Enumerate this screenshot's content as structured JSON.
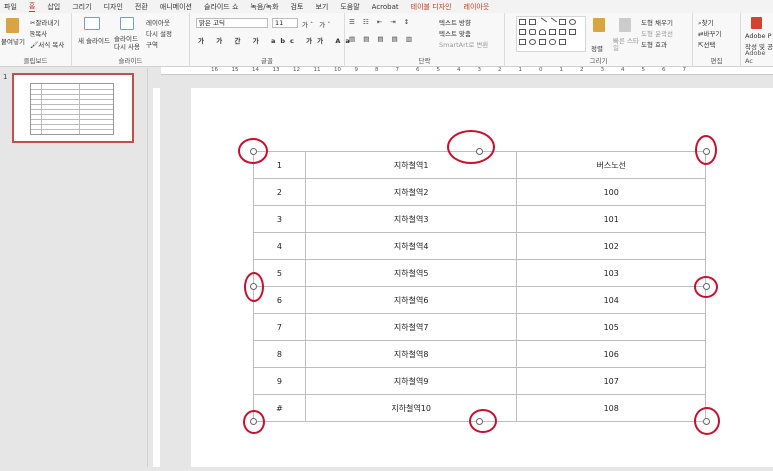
{
  "menu": {
    "tabs": [
      "파일",
      "홈",
      "삽입",
      "그리기",
      "디자인",
      "전환",
      "애니메이션",
      "슬라이드 쇼",
      "녹음/녹화",
      "검토",
      "보기",
      "도움말",
      "Acrobat",
      "테이블 디자인",
      "레이아웃"
    ]
  },
  "ribbon": {
    "clipboard": {
      "paste": "붙여넣기",
      "cut": "잘라내기",
      "copy": "복사",
      "format_painter": "서식 복사",
      "label": "클립보드"
    },
    "slides": {
      "new_slide": "새 슬라이드",
      "reuse": "슬라이드 다시 사용",
      "layout": "레이아웃",
      "reset": "다시 설정",
      "section": "구역",
      "label": "슬라이드"
    },
    "font": {
      "name": "맑은 고딕",
      "size": "11",
      "label": "글꼴"
    },
    "paragraph": {
      "text_direction": "텍스트 방향",
      "align_text": "텍스트 맞춤",
      "smartart": "SmartArt로 변환",
      "label": "단락"
    },
    "drawing": {
      "arrange": "정렬",
      "quick_styles": "빠른 스타일",
      "fill": "도형 채우기",
      "outline": "도형 윤곽선",
      "effects": "도형 효과",
      "label": "그리기"
    },
    "editing": {
      "find": "찾기",
      "replace": "바꾸기",
      "select": "선택",
      "label": "편집"
    },
    "adobe": {
      "line1": "Adobe P",
      "line2": "작성 및 공",
      "label": "Adobe Ac"
    }
  },
  "thumbnail": {
    "number": "1"
  },
  "ruler": {
    "ticks": [
      "16",
      "15",
      "14",
      "13",
      "12",
      "11",
      "10",
      "9",
      "8",
      "7",
      "6",
      "5",
      "4",
      "3",
      "2",
      "1",
      "0",
      "1",
      "2",
      "3",
      "4",
      "5",
      "6",
      "7"
    ]
  },
  "table": {
    "rows": [
      [
        "1",
        "지하철역1",
        "버스노선"
      ],
      [
        "2",
        "지하철역2",
        "100"
      ],
      [
        "3",
        "지하철역3",
        "101"
      ],
      [
        "4",
        "지하철역4",
        "102"
      ],
      [
        "5",
        "지하철역5",
        "103"
      ],
      [
        "6",
        "지하철역6",
        "104"
      ],
      [
        "7",
        "지하철역7",
        "105"
      ],
      [
        "8",
        "지하철역8",
        "106"
      ],
      [
        "9",
        "지하철역9",
        "107"
      ],
      [
        "#",
        "지하철역10",
        "108"
      ]
    ]
  },
  "annotation_color": "#c8102e"
}
